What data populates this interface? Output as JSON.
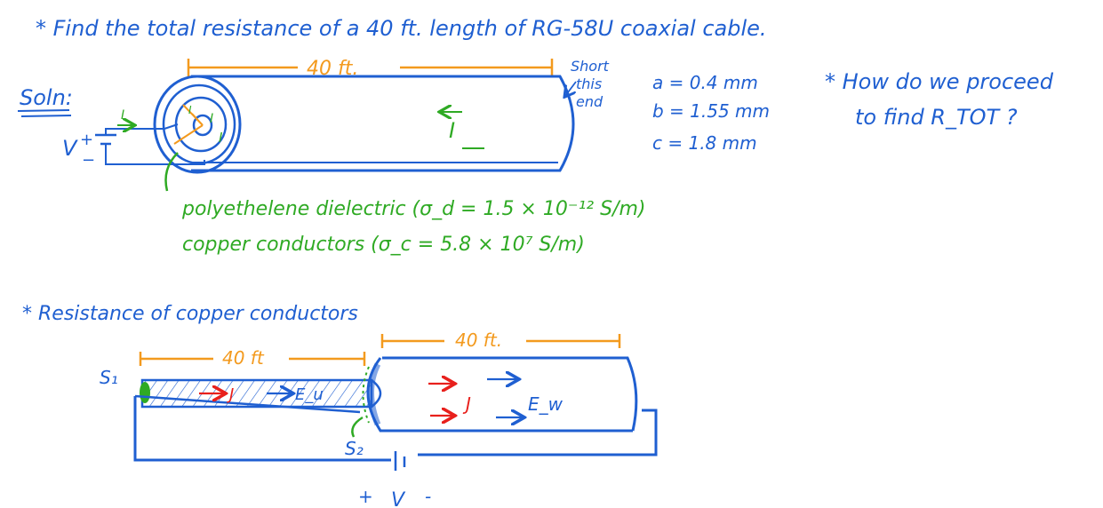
{
  "colors": {
    "blue_ink": "#1f5fd1",
    "orange_ink": "#f39a1e",
    "green_ink": "#2faa24",
    "red_ink": "#e8201c",
    "background": "#ffffff"
  },
  "problem": "* Find the total resistance of a 40 ft. length of RG-58U coaxial cable.",
  "solution_label": "Soln:",
  "top_cable": {
    "length_label": "40 ft.",
    "short_note_lines": [
      "Short",
      "this",
      "end"
    ],
    "current_label": "I",
    "source_plus": "+",
    "source_minus": "−",
    "source_label": "V",
    "inner_labels": [
      "I",
      "I",
      "I"
    ]
  },
  "dimensions": [
    "a = 0.4 mm",
    "b = 1.55 mm",
    "c = 1.8 mm"
  ],
  "question_lines": [
    "* How do we proceed",
    "to find R_TOT ?"
  ],
  "materials": {
    "dielectric": "polyethelene dielectric (σ_d = 1.5 × 10⁻¹² S/m)",
    "conductors": "copper conductors (σ_c = 5.8 × 10⁷ S/m)"
  },
  "section_heading": "* Resistance of copper conductors",
  "bottom_cable": {
    "length_left": "40 ft",
    "length_right": "40 ft.",
    "s1": "S₁",
    "s2": "S₂",
    "j_inner": "J",
    "e_inner": "E_u",
    "j_outer": "J",
    "e_outer": "E_w",
    "v_plus": "+",
    "v_label": "V",
    "v_minus": "-"
  }
}
